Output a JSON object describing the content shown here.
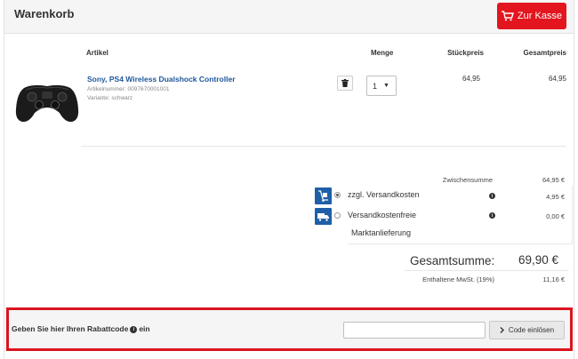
{
  "cart": {
    "title": "Warenkorb",
    "checkout_label": "Zur Kasse"
  },
  "columns": {
    "article": "Artikel",
    "quantity": "Menge",
    "unit_price": "Stückpreis",
    "total_price": "Gesamtpreis"
  },
  "item": {
    "name": "Sony, PS4 Wireless Dualshock Controller",
    "article_number": "Artikelnummer: 0097670001001",
    "variant": "Variante: schwarz",
    "quantity": "1",
    "unit_price": "64,95",
    "total_price": "64,95"
  },
  "summary": {
    "subtotal_label": "Zwischensumme",
    "subtotal_value": "64,95 €",
    "shipping_option_1": "zzgl. Versandkosten",
    "shipping_value_1": "4,95 €",
    "shipping_option_2": "Versandkostenfreie",
    "shipping_option_2_sub": "Marktanlieferung",
    "shipping_value_2": "0,00 €",
    "total_label": "Gesamtsumme:",
    "total_value": "69,90 €",
    "vat_label": "Enthaltene MwSt. (19%)",
    "vat_value": "11,16 €"
  },
  "coupon": {
    "label_before": "Geben Sie hier Ihren Rabattcode",
    "label_after": "ein",
    "input_value": "",
    "button_label": "Code einlösen"
  },
  "colors": {
    "accent": "#e3151e",
    "link": "#1e5799",
    "shipping_icon_bg": "#1f5fa7"
  },
  "icons": {
    "cart": "shopping-cart-icon",
    "trash": "trash-icon",
    "info": "info-icon",
    "shipping": "hand-truck-icon",
    "delivery": "delivery-truck-icon",
    "chevron": "chevron-right-icon"
  }
}
